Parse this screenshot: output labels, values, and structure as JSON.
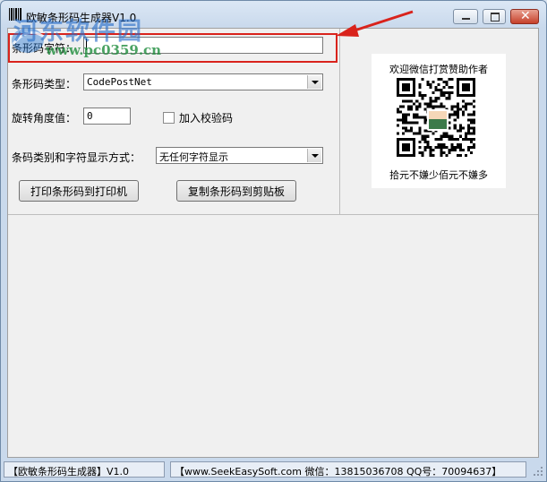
{
  "window": {
    "title": "欧敏条形码生成器V1.0",
    "watermark_text": "河东软件园",
    "watermark_url": "www.pc0359.cn"
  },
  "form": {
    "barcode_text_label": "条形码字符：",
    "barcode_text_value": "",
    "barcode_type_label": "条形码类型：",
    "barcode_type_value": "CodePostNet",
    "rotation_label": "旋转角度值：",
    "rotation_value": "0",
    "checksum_label": "加入校验码",
    "checksum_checked": false,
    "display_mode_label": "条码类别和字符显示方式：",
    "display_mode_value": "无任何字符显示",
    "print_button": "打印条形码到打印机",
    "copy_button": "复制条形码到剪贴板"
  },
  "donation": {
    "title": "欢迎微信打赏赞助作者",
    "caption": "拾元不嫌少佰元不嫌多"
  },
  "status": {
    "app_name": "【欧敏条形码生成器】V1.0",
    "contact": "【www.SeekEasySoft.com 微信：13815036708 QQ号：70094637】"
  },
  "colors": {
    "highlight_border": "#d9231c",
    "annotation_arrow": "#d9231c"
  }
}
